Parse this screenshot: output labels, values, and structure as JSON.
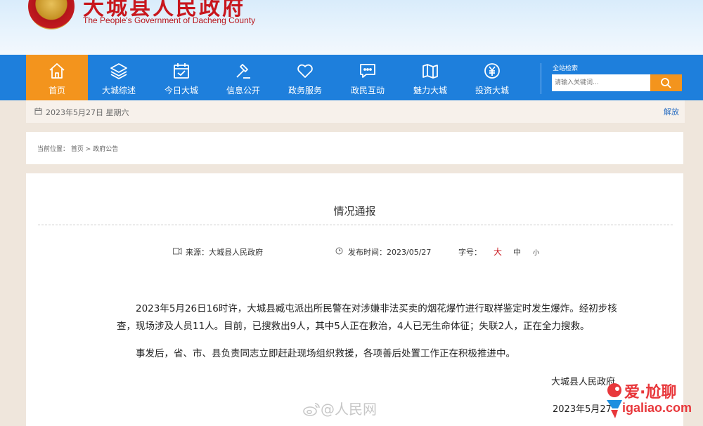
{
  "header": {
    "site_name_cn": "大城县人民政府",
    "site_name_en": "The People's Government of Dacheng County"
  },
  "nav": {
    "items": [
      {
        "label": "首页",
        "icon": "home-icon",
        "active": true
      },
      {
        "label": "大城综述",
        "icon": "layers-icon"
      },
      {
        "label": "今日大城",
        "icon": "calendar-check-icon"
      },
      {
        "label": "信息公开",
        "icon": "hammer-icon"
      },
      {
        "label": "政务服务",
        "icon": "heart-icon"
      },
      {
        "label": "政民互动",
        "icon": "chat-icon"
      },
      {
        "label": "魅力大城",
        "icon": "map-icon"
      },
      {
        "label": "投资大城",
        "icon": "yuan-coin-icon"
      }
    ],
    "search": {
      "title": "全站检索",
      "placeholder": "请输入关键词..."
    }
  },
  "datebar": {
    "date": "2023年5月27日 星期六",
    "weather_link": "解放"
  },
  "breadcrumb": {
    "prefix": "当前位置：",
    "home": "首页",
    "separator": ">",
    "current": "政府公告"
  },
  "article": {
    "title": "情况通报",
    "source_label": "来源：",
    "source": "大城县人民政府",
    "publish_label": "发布时间：",
    "publish_date": "2023/05/27",
    "font_size_label": "字号：",
    "font_sizes": [
      "大",
      "中",
      "小"
    ],
    "paragraphs": [
      "2023年5月26日16时许，大城县臧屯派出所民警在对涉嫌非法买卖的烟花爆竹进行取样鉴定时发生爆炸。经初步核查，现场涉及人员11人。目前，已搜救出9人，其中5人正在救治，4人已无生命体征；失联2人，正在全力搜救。",
      "事发后，省、市、县负责同志立即赶赴现场组织救援，各项善后处置工作正在积极推进中。"
    ],
    "signature": "大城县人民政府",
    "sign_date": "2023年5月27"
  },
  "overlays": {
    "weibo_watermark": "@人民网",
    "corner_cn": "爱·尬聊",
    "corner_url": "igaliao.com"
  },
  "colors": {
    "nav_blue": "#1e7fdc",
    "accent_orange": "#f3941d",
    "title_red": "#c8161d"
  }
}
